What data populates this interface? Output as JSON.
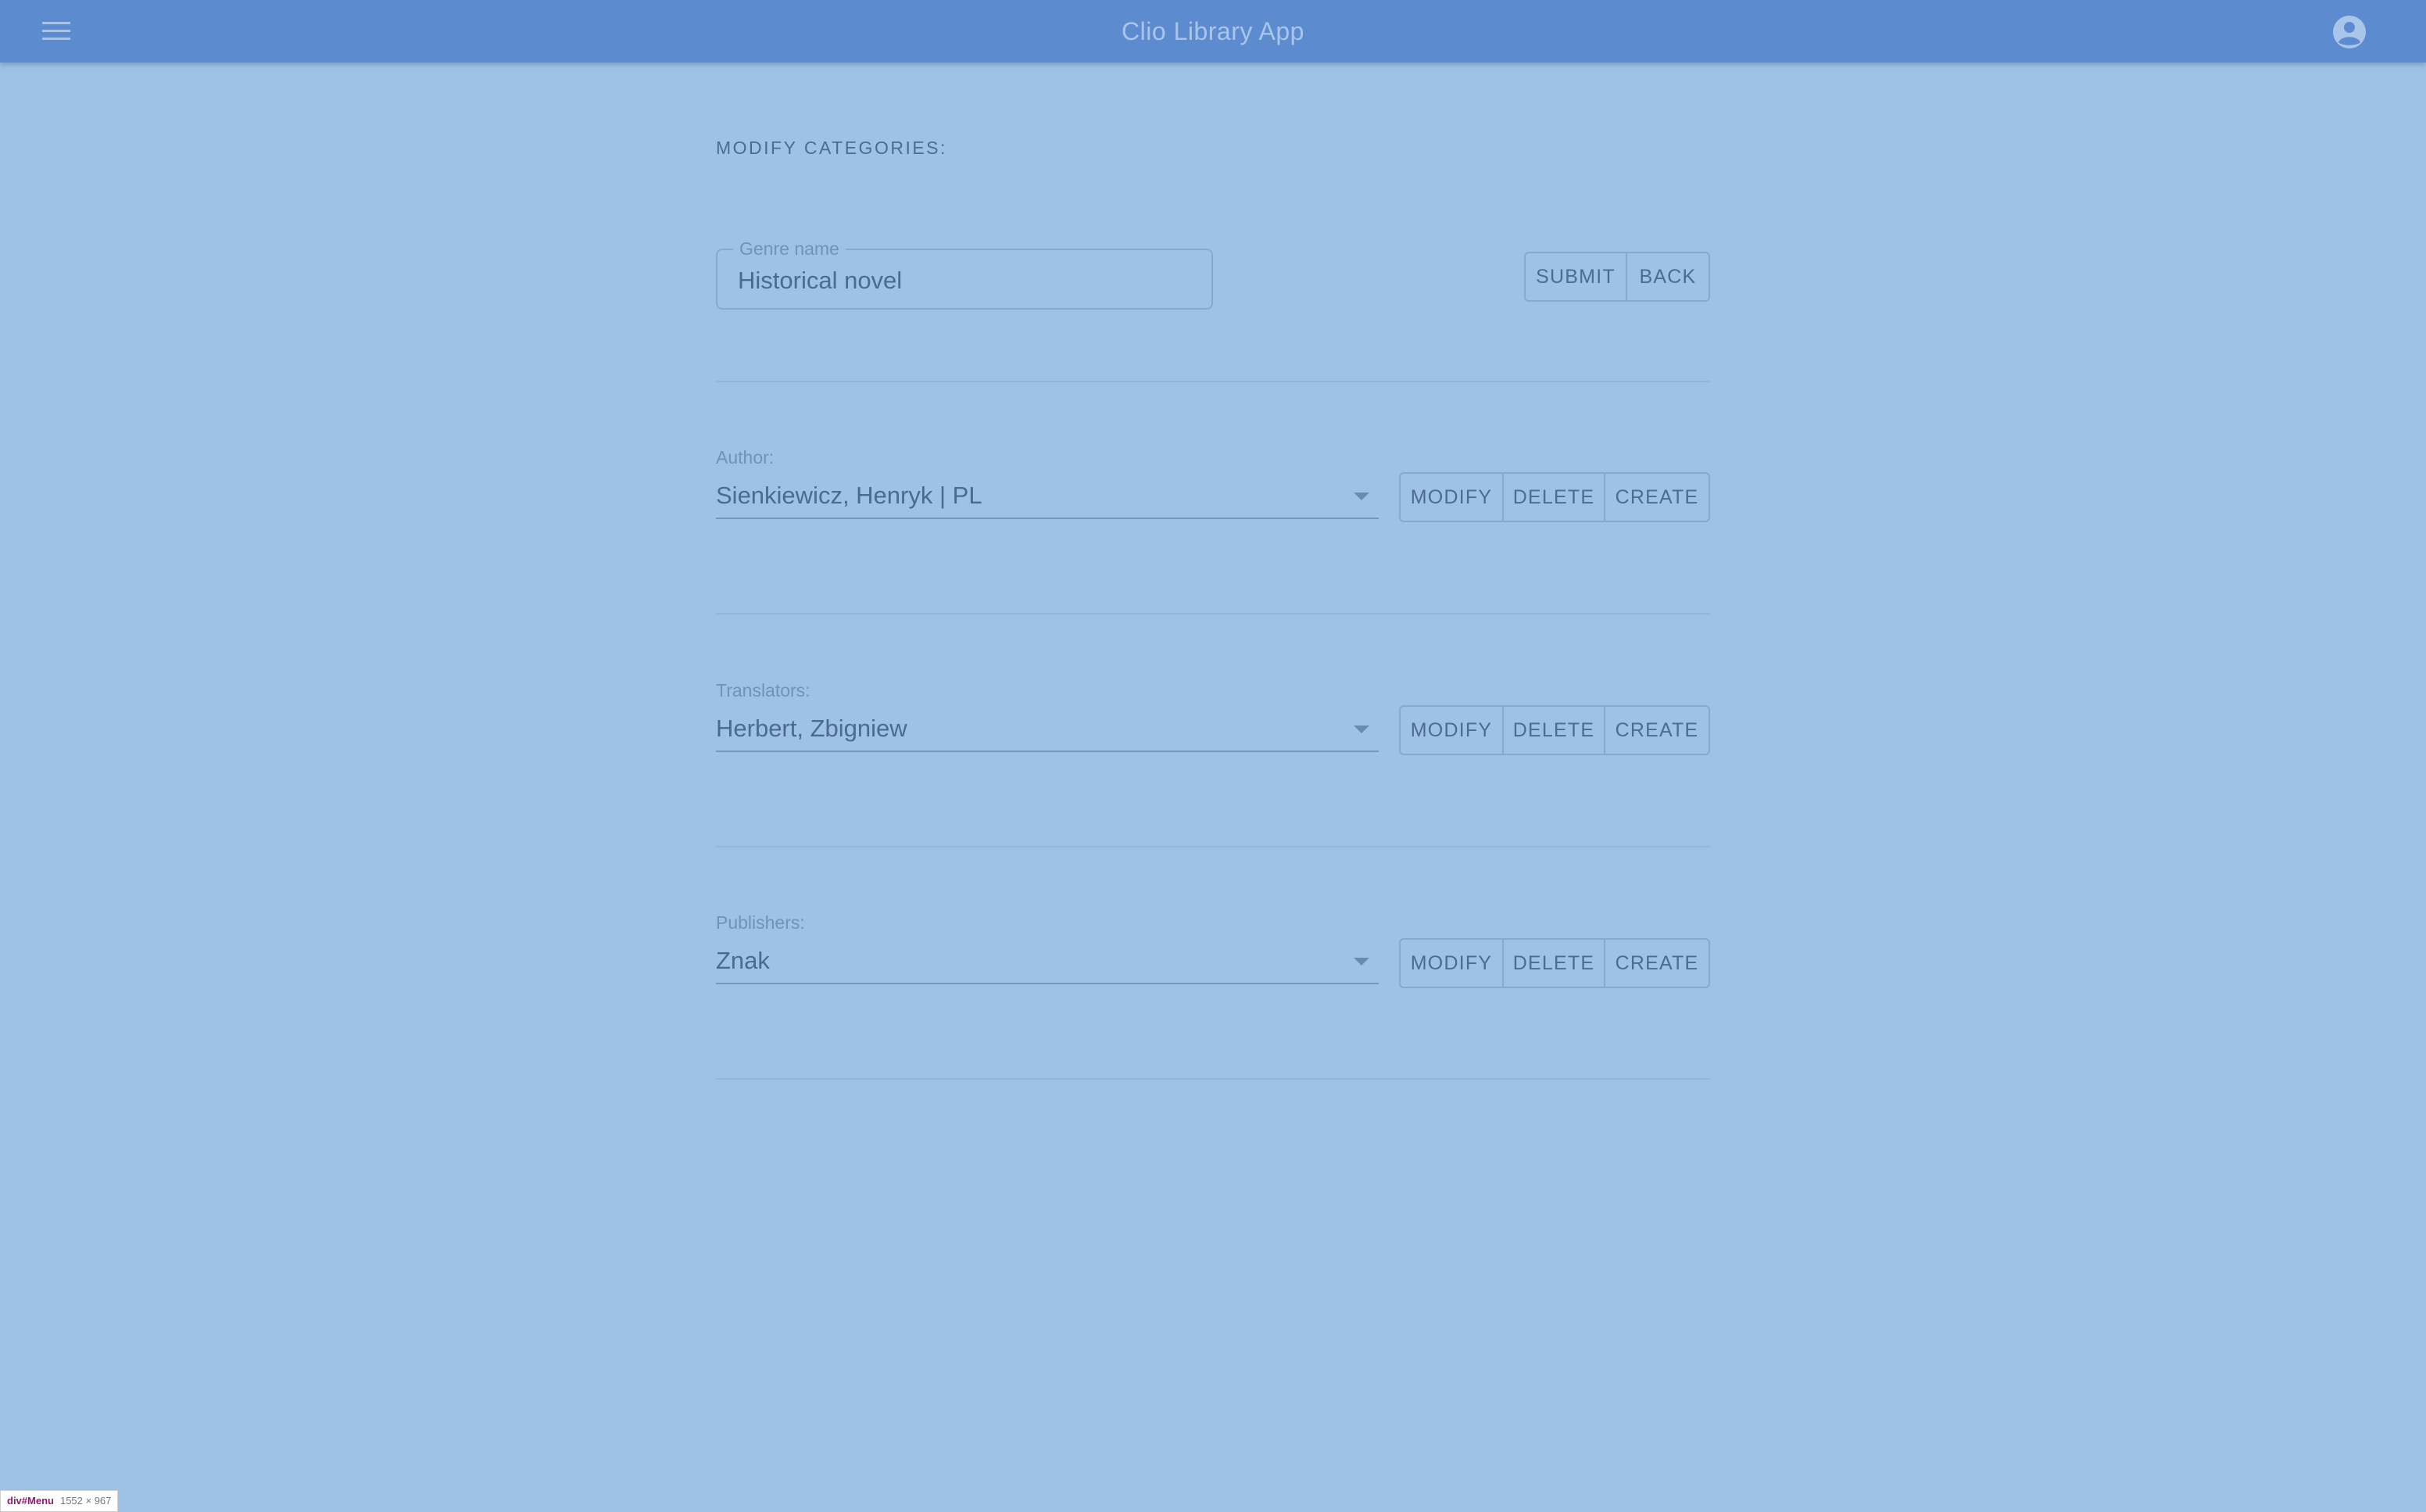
{
  "app": {
    "title": "Clio Library App",
    "menu_icon": "hamburger-menu-icon",
    "account_icon": "account-circle-icon"
  },
  "page": {
    "heading": "MODIFY CATEGORIES:"
  },
  "genre": {
    "label": "Genre name",
    "value": "Historical novel",
    "submit_label": "SUBMIT",
    "back_label": "BACK"
  },
  "author": {
    "label": "Author:",
    "selected": "Sienkiewicz, Henryk | PL",
    "modify_label": "MODIFY",
    "delete_label": "DELETE",
    "create_label": "CREATE"
  },
  "translators": {
    "label": "Translators:",
    "selected": "Herbert, Zbigniew",
    "modify_label": "MODIFY",
    "delete_label": "DELETE",
    "create_label": "CREATE"
  },
  "publishers": {
    "label": "Publishers:",
    "selected": "Znak",
    "modify_label": "MODIFY",
    "delete_label": "DELETE",
    "create_label": "CREATE"
  },
  "debug_badge": {
    "element": "div#Menu",
    "size": "1552 × 967"
  },
  "colors": {
    "background": "#9ec2e6",
    "appbar": "#5d8bd0",
    "text": "#4a6a93",
    "border": "#86a8d1"
  }
}
